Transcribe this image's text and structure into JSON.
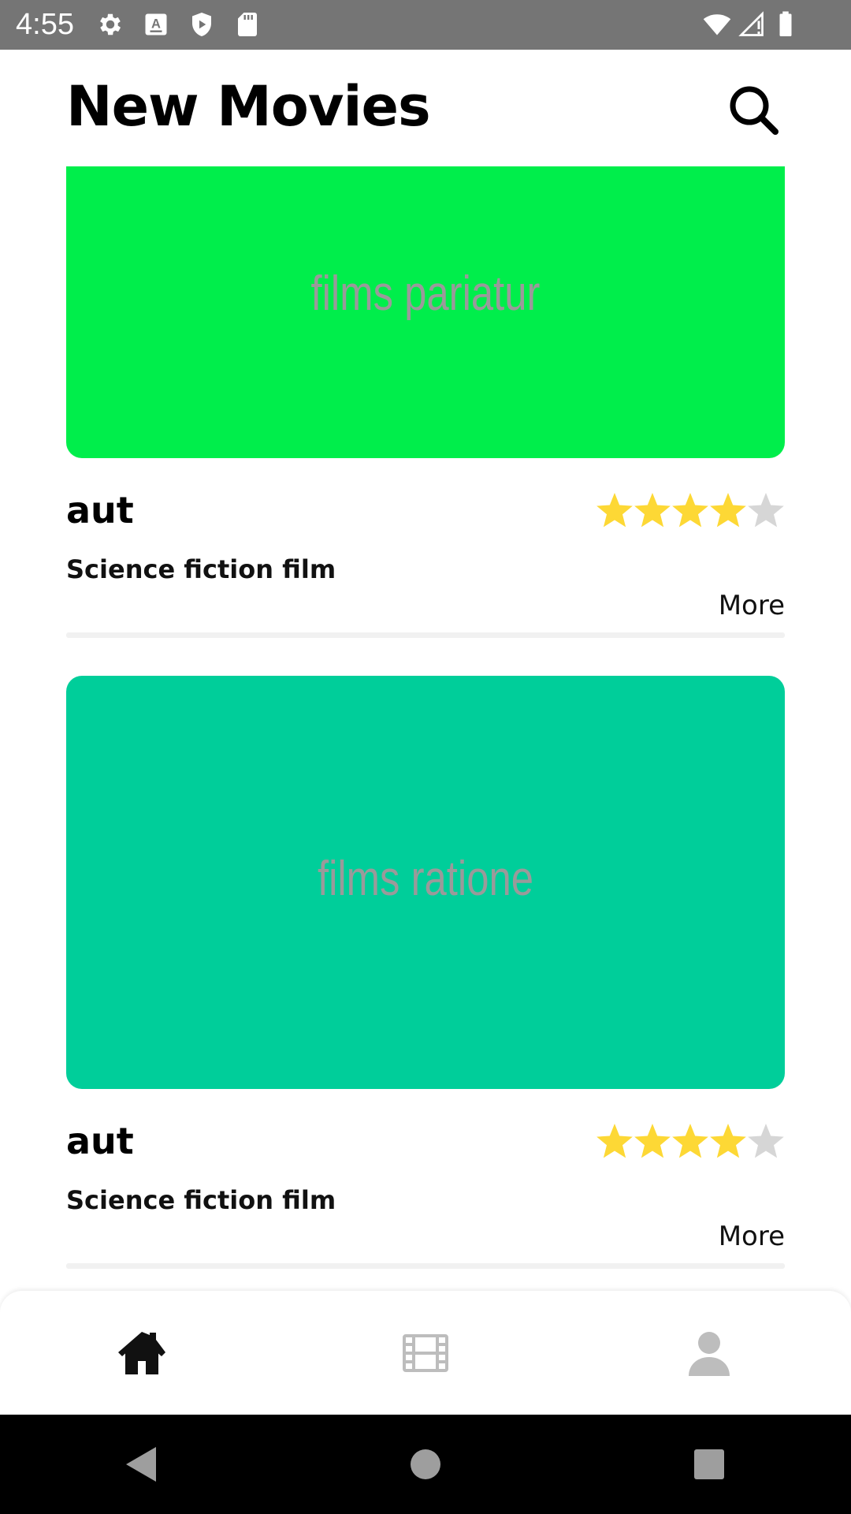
{
  "status_bar": {
    "time": "4:55",
    "left_icons": [
      "settings-icon",
      "keyboard-a-icon",
      "play-protect-icon",
      "sd-card-icon"
    ],
    "right_icons": [
      "wifi-icon",
      "signal-icon",
      "battery-icon"
    ]
  },
  "header": {
    "title": "New Movies",
    "search_icon": "search-icon"
  },
  "movies": [
    {
      "poster_text": "films pariatur",
      "poster_color": "#00EE4B",
      "title": "aut",
      "rating": 4,
      "max_rating": 5,
      "genre": "Science fiction film",
      "more_label": "More"
    },
    {
      "poster_text": "films ratione",
      "poster_color": "#00CE9A",
      "title": "aut",
      "rating": 4,
      "max_rating": 5,
      "genre": "Science fiction film",
      "more_label": "More"
    }
  ],
  "bottom_nav": {
    "items": [
      {
        "icon": "home-icon",
        "active": true
      },
      {
        "icon": "film-icon",
        "active": false
      },
      {
        "icon": "profile-icon",
        "active": false
      }
    ],
    "active_color": "#111111",
    "inactive_color": "#BDBDBD"
  },
  "colors": {
    "star_filled": "#FDD835",
    "star_empty": "#D6D6D6"
  },
  "system_nav": [
    "back-icon",
    "home-circle-icon",
    "recents-icon"
  ]
}
